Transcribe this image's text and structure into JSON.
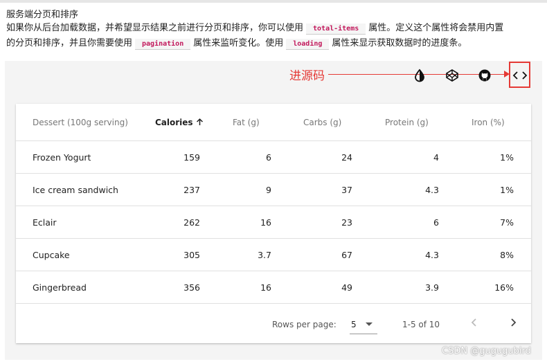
{
  "doc": {
    "heading": "服务端分页和排序",
    "line1_a": "如果你从后台加载数据，并希望显示结果之前进行分页和排序，你可以使用",
    "code1": "total-items",
    "line1_b": "属性。定义这个属性将会禁用内置",
    "line2_a": "的分页和排序，并且你需要使用",
    "code2": "pagination",
    "line2_b": "属性来监听变化。使用",
    "code3": "loading",
    "line2_c": "属性来显示获取数据时的进度条。"
  },
  "annotation": {
    "label": "进源码",
    "color": "#e53935"
  },
  "toolbar": {
    "icons": [
      "invert-colors-icon",
      "codepen-icon",
      "github-icon",
      "code-icon"
    ]
  },
  "table": {
    "headers": [
      "Dessert (100g serving)",
      "Calories",
      "Fat (g)",
      "Carbs (g)",
      "Protein (g)",
      "Iron (%)"
    ],
    "sort_column": "Calories",
    "sort_direction": "ascending",
    "rows": [
      [
        "Frozen Yogurt",
        "159",
        "6",
        "24",
        "4",
        "1%"
      ],
      [
        "Ice cream sandwich",
        "237",
        "9",
        "37",
        "4.3",
        "1%"
      ],
      [
        "Eclair",
        "262",
        "16",
        "23",
        "6",
        "7%"
      ],
      [
        "Cupcake",
        "305",
        "3.7",
        "67",
        "4.3",
        "8%"
      ],
      [
        "Gingerbread",
        "356",
        "16",
        "49",
        "3.9",
        "16%"
      ]
    ]
  },
  "pagination": {
    "rows_per_page_label": "Rows per page:",
    "rows_per_page_value": "5",
    "range_text": "1-5 of 10"
  },
  "watermark": "CSDN @gugugubird"
}
